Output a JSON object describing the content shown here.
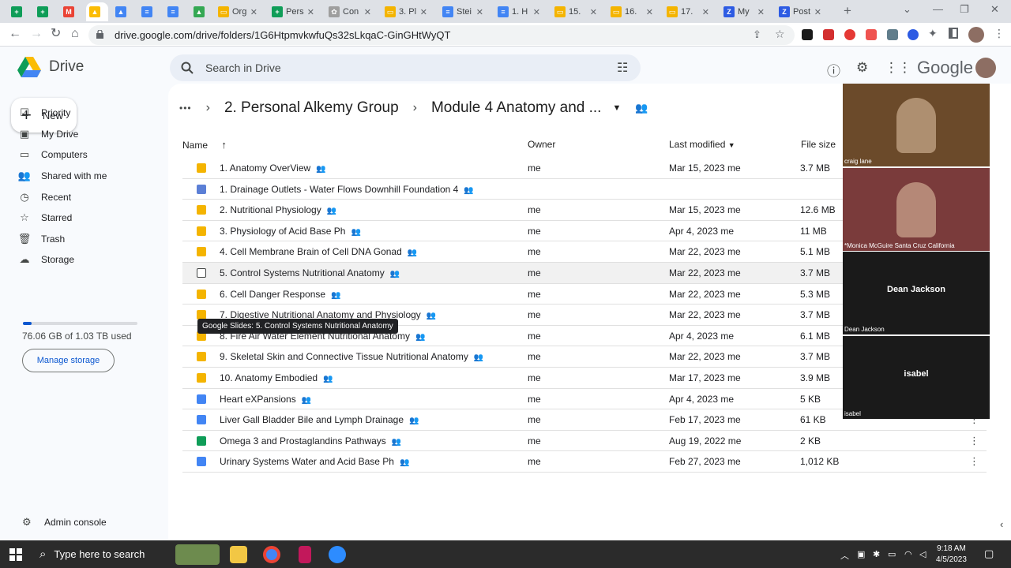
{
  "tabs": [
    {
      "label": "",
      "color": "#0f9d58",
      "glyph": "+"
    },
    {
      "label": "",
      "color": "#0f9d58",
      "glyph": "+"
    },
    {
      "label": "",
      "color": "#ea4335",
      "glyph": "M"
    },
    {
      "label": "",
      "color": "#fbbc04",
      "glyph": "▲"
    },
    {
      "label": "",
      "color": "#4285f4",
      "glyph": "▲"
    },
    {
      "label": "",
      "color": "#4285f4",
      "glyph": "≡"
    },
    {
      "label": "",
      "color": "#4285f4",
      "glyph": "≡"
    },
    {
      "label": "",
      "color": "#34a853",
      "glyph": "▲"
    },
    {
      "label": "Org",
      "color": "#f4b400",
      "glyph": "▭"
    },
    {
      "label": "Pers",
      "color": "#0f9d58",
      "glyph": "+"
    },
    {
      "label": "Con",
      "color": "#9e9e9e",
      "glyph": "✿"
    },
    {
      "label": "3. Pl",
      "color": "#f4b400",
      "glyph": "▭"
    },
    {
      "label": "Stei",
      "color": "#4285f4",
      "glyph": "≡"
    },
    {
      "label": "1. H",
      "color": "#4285f4",
      "glyph": "≡"
    },
    {
      "label": "15.",
      "color": "#f4b400",
      "glyph": "▭"
    },
    {
      "label": "16.",
      "color": "#f4b400",
      "glyph": "▭"
    },
    {
      "label": "17.",
      "color": "#f4b400",
      "glyph": "▭"
    },
    {
      "label": "My",
      "color": "#2d5be3",
      "glyph": "Z"
    },
    {
      "label": "Post",
      "color": "#2d5be3",
      "glyph": "Z"
    }
  ],
  "url": "drive.google.com/drive/folders/1G6HtpmvkwfuQs32sLkqaC-GinGHtWyQT",
  "app": {
    "name": "Drive",
    "search_placeholder": "Search in Drive",
    "wordmark": "Google"
  },
  "sidebar": {
    "new_label": "New",
    "items": [
      {
        "label": "Priority",
        "icon": "priority-icon",
        "glyph": "☑"
      },
      {
        "label": "My Drive",
        "icon": "my-drive-icon",
        "glyph": "▣"
      },
      {
        "label": "Computers",
        "icon": "computers-icon",
        "glyph": "▭"
      },
      {
        "label": "Shared with me",
        "icon": "shared-icon",
        "glyph": "👥"
      },
      {
        "label": "Recent",
        "icon": "recent-icon",
        "glyph": "◷"
      },
      {
        "label": "Starred",
        "icon": "star-icon",
        "glyph": "☆"
      },
      {
        "label": "Trash",
        "icon": "trash-icon",
        "glyph": "🗑"
      },
      {
        "label": "Storage",
        "icon": "cloud-icon",
        "glyph": "☁"
      }
    ],
    "storage_used": "76.06 GB of 1.03 TB used",
    "storage_fraction": 0.074,
    "manage_storage": "Manage storage",
    "admin_console": "Admin console"
  },
  "breadcrumb": {
    "ellipsis": "•••",
    "parent": "2. Personal Alkemy Group",
    "current": "Module 4 Anatomy and ..."
  },
  "table": {
    "headers": {
      "name": "Name",
      "owner": "Owner",
      "modified": "Last modified",
      "size": "File size"
    },
    "rows": [
      {
        "name": "1. Anatomy OverView",
        "type": "slides",
        "owner": "me",
        "modified": "Mar 15, 2023 me",
        "size": "3.7 MB"
      },
      {
        "name": "1. Drainage Outlets - Water Flows Downhill Foundation 4",
        "type": "form",
        "owner": "",
        "modified": "",
        "size": ""
      },
      {
        "name": "2. Nutritional Physiology",
        "type": "slides",
        "owner": "me",
        "modified": "Mar 15, 2023 me",
        "size": "12.6 MB"
      },
      {
        "name": "3. Physiology of Acid Base Ph",
        "type": "slides",
        "owner": "me",
        "modified": "Apr 4, 2023 me",
        "size": "11 MB"
      },
      {
        "name": "4. Cell Membrane Brain of Cell DNA Gonad",
        "type": "slides",
        "owner": "me",
        "modified": "Mar 22, 2023 me",
        "size": "5.1 MB"
      },
      {
        "name": "5. Control Systems Nutritional Anatomy",
        "type": "checkbox",
        "owner": "me",
        "modified": "Mar 22, 2023 me",
        "size": "3.7 MB"
      },
      {
        "name": "6. Cell Danger Response",
        "type": "slides",
        "owner": "me",
        "modified": "Mar 22, 2023 me",
        "size": "5.3 MB"
      },
      {
        "name": "7. Digestive Nutritional Anatomy and Physiology",
        "type": "slides",
        "owner": "me",
        "modified": "Mar 22, 2023 me",
        "size": "3.7 MB"
      },
      {
        "name": "8. Fire Air Water Element Nutritional Anatomy",
        "type": "slides",
        "owner": "me",
        "modified": "Apr 4, 2023 me",
        "size": "6.1 MB"
      },
      {
        "name": "9. Skeletal Skin and Connective Tissue Nutritional Anatomy",
        "type": "slides",
        "owner": "me",
        "modified": "Mar 22, 2023 me",
        "size": "3.7 MB"
      },
      {
        "name": "10. Anatomy Embodied",
        "type": "slides",
        "owner": "me",
        "modified": "Mar 17, 2023 me",
        "size": "3.9 MB"
      },
      {
        "name": "Heart eXPansions",
        "type": "docs",
        "owner": "me",
        "modified": "Apr 4, 2023 me",
        "size": "5 KB"
      },
      {
        "name": "Liver Gall Bladder Bile and Lymph Drainage",
        "type": "docs",
        "owner": "me",
        "modified": "Feb 17, 2023 me",
        "size": "61 KB"
      },
      {
        "name": "Omega 3 and Prostaglandins Pathways",
        "type": "sheets",
        "owner": "me",
        "modified": "Aug 19, 2022 me",
        "size": "2 KB"
      },
      {
        "name": "Urinary Systems Water and Acid Base Ph",
        "type": "docs",
        "owner": "me",
        "modified": "Feb 27, 2023 me",
        "size": "1,012 KB"
      }
    ]
  },
  "tooltip": "Google Slides: 5. Control Systems Nutritional Anatomy",
  "participants": [
    {
      "name": "craig lane",
      "center": "",
      "bg": "#6b4a2a"
    },
    {
      "name": "*Monica McGuire Santa Cruz California",
      "center": "",
      "bg": "#7a3b3b"
    },
    {
      "name": "Dean Jackson",
      "center": "Dean Jackson",
      "bg": "#1a1a1a"
    },
    {
      "name": "isabel",
      "center": "isabel",
      "bg": "#1a1a1a"
    }
  ],
  "taskbar": {
    "search_placeholder": "Type here to search",
    "time": "9:18 AM",
    "date": "4/5/2023"
  },
  "colors": {
    "slides": "#f4b400",
    "docs": "#4285f4",
    "sheets": "#0f9d58",
    "form": "#5b7fd6",
    "accent": "#0b57d0"
  }
}
